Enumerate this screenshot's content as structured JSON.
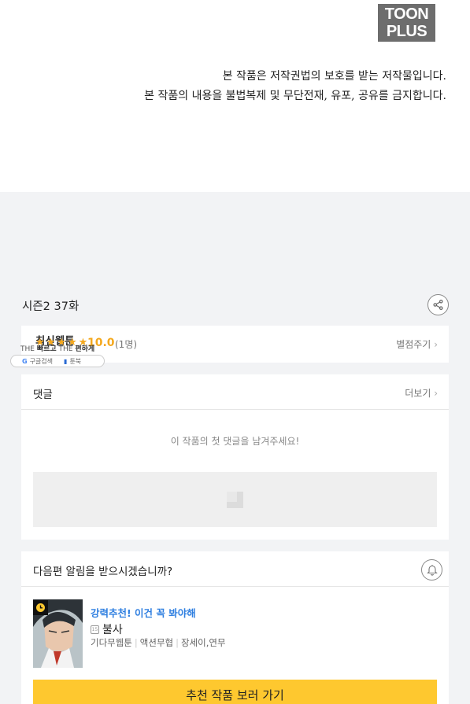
{
  "logo": {
    "line1": "TOON",
    "line2": "PLUS"
  },
  "copyright": {
    "line1": "본 작품은 저작권법의 보호를 받는 저작물입니다.",
    "line2": "본 작품의 내용을 불법복제 및 무단전재, 유포, 공유를 금지합니다."
  },
  "episode": {
    "title": "시즌2 37화"
  },
  "rating": {
    "category": "최신웹툰",
    "stars": "★★★★★",
    "score": "10.0",
    "count": "(1명)",
    "rate_link": "별점주기"
  },
  "overlay": {
    "tag_prefix": "THE ",
    "tag_bold1": "빠르고",
    "tag_mid": " THE ",
    "tag_bold2": "편하게",
    "pill_g": "G",
    "pill_label1": "구글검색",
    "pill_label2": "툰북"
  },
  "comments": {
    "title": "댓글",
    "more_link": "더보기",
    "empty_text": "이 작품의 첫 댓글을 남겨주세요!"
  },
  "alert": {
    "title": "다음편 알림을 받으시겠습니까?",
    "rec_label": "강력추천! 이건 꼭 봐야해",
    "age_badge": "15",
    "rec_title": "불사",
    "rec_tags": [
      "기다무웹툰",
      "액션무협",
      "장세이,연무"
    ],
    "cta_label": "추천 작품 보러 가기"
  },
  "colors": {
    "accent_orange": "#f4a81d",
    "accent_blue": "#2f7fe0",
    "cta_yellow": "#fec82f"
  },
  "icons": [
    "share-icon",
    "chevron-right-icon",
    "bell-icon",
    "clock-icon",
    "image-placeholder-icon"
  ]
}
